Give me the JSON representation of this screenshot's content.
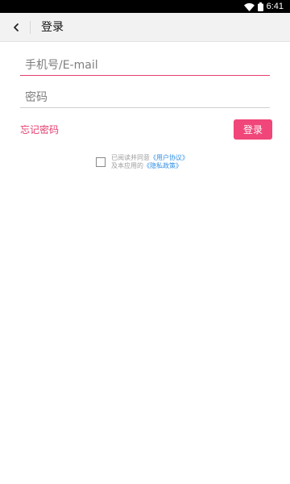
{
  "status_bar": {
    "time": "6:41",
    "icons": [
      "wifi-icon",
      "battery-icon"
    ]
  },
  "app_bar": {
    "back_icon": "chevron-left-icon",
    "title": "登录"
  },
  "form": {
    "phone_placeholder": "手机号/E-mail",
    "phone_value": "",
    "password_placeholder": "密码",
    "password_value": ""
  },
  "actions": {
    "forgot_label": "忘记密码",
    "login_label": "登录"
  },
  "agreement": {
    "checked": false,
    "text_prefix": "已阅读并同意",
    "user_agreement": "《用户协议》",
    "text_middle": "及本应用的",
    "privacy_policy": "《隐私政策》"
  },
  "colors": {
    "accent": "#f0467a",
    "link": "#2f8fe6",
    "app_bar_bg": "#f2f2f2"
  }
}
